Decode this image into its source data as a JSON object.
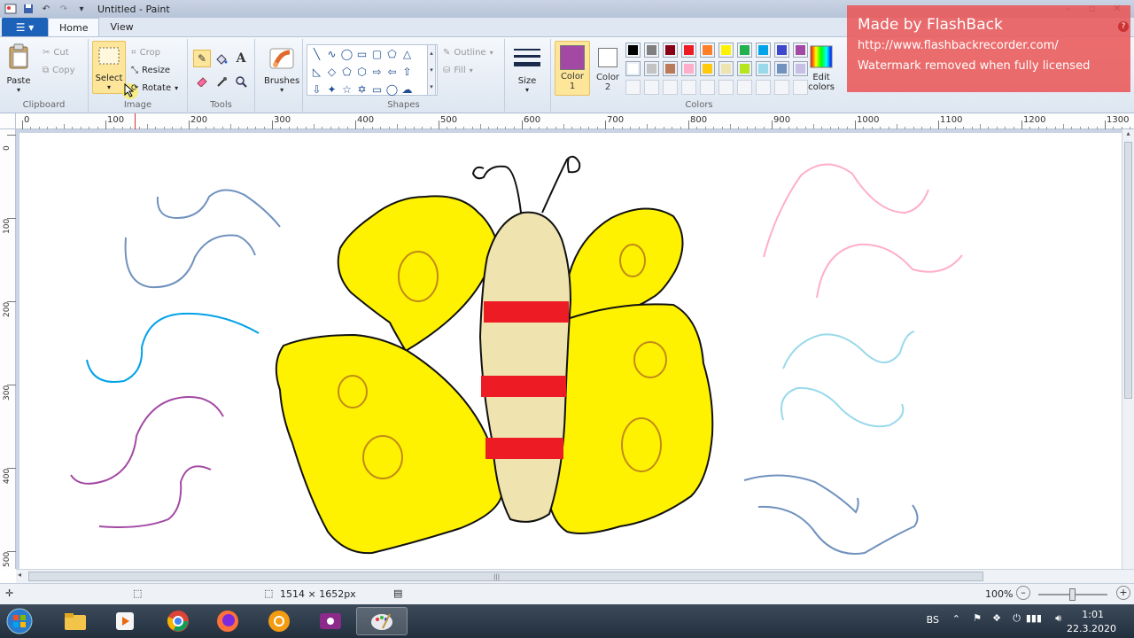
{
  "window": {
    "title": "Untitled - Paint"
  },
  "tabs": {
    "file_icon": "menu-icon",
    "items": [
      "Home",
      "View"
    ]
  },
  "clipboard": {
    "paste": "Paste",
    "cut": "Cut",
    "copy": "Copy",
    "group_label": "Clipboard"
  },
  "image": {
    "select": "Select",
    "crop": "Crop",
    "resize": "Resize",
    "rotate": "Rotate",
    "group_label": "Image"
  },
  "tools": {
    "group_label": "Tools",
    "text_glyph": "A"
  },
  "brushes": {
    "label": "Brushes"
  },
  "shapes": {
    "outline": "Outline",
    "fill": "Fill",
    "group_label": "Shapes"
  },
  "size": {
    "label": "Size"
  },
  "colors": {
    "color1_label": "Color",
    "color1_num": "1",
    "color2_label": "Color",
    "color2_num": "2",
    "edit_colors_line1": "Edit",
    "edit_colors_line2": "colors",
    "group_label": "Colors",
    "color1_value": "#a349a4",
    "color2_value": "#ffffff",
    "palette_row1": [
      "#000000",
      "#7f7f7f",
      "#880015",
      "#ed1c24",
      "#ff7f27",
      "#fff200",
      "#22b14c",
      "#00a2e8",
      "#3f48cc",
      "#a349a4"
    ],
    "palette_row2": [
      "#ffffff",
      "#c3c3c3",
      "#b97a57",
      "#ffaec9",
      "#ffc90e",
      "#efe4b0",
      "#b5e61d",
      "#99d9ea",
      "#7092be",
      "#c8bfe7"
    ]
  },
  "watermark": {
    "line1": "Made by FlashBack",
    "line2": "http://www.flashbackrecorder.com/",
    "line3": "Watermark removed when fully licensed"
  },
  "ruler": {
    "h_labels": [
      "0",
      "100",
      "200",
      "300",
      "400",
      "500",
      "600",
      "700",
      "800",
      "900",
      "1000",
      "1100",
      "1200",
      "1300"
    ],
    "v_labels": [
      "0",
      "100",
      "200",
      "300",
      "400",
      "500"
    ]
  },
  "status": {
    "image_size": "1514 × 1652px",
    "zoom": "100%"
  },
  "taskbar": {
    "language": "BS",
    "time": "1:01",
    "date": "22.3.2020"
  }
}
